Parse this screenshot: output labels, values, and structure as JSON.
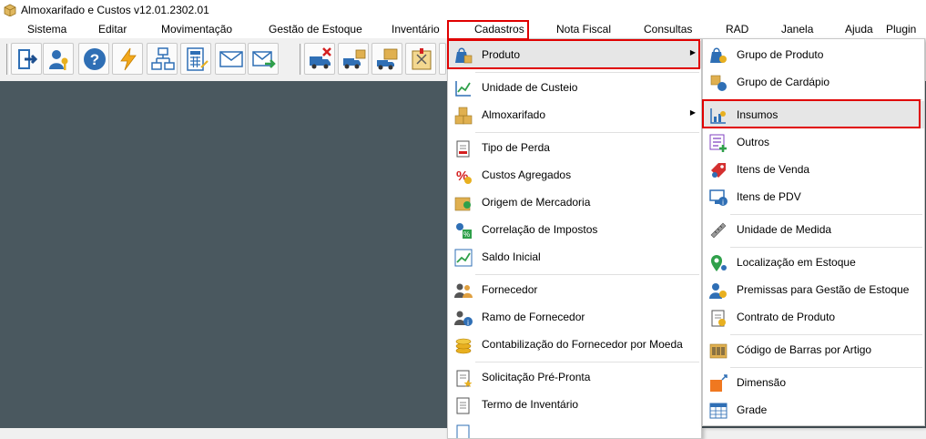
{
  "window": {
    "title": "Almoxarifado e Custos v12.01.2302.01"
  },
  "menubar": {
    "items": [
      "Sistema",
      "Editar",
      "Movimentação",
      "Gestão de Estoque",
      "Inventário",
      "Cadastros",
      "Nota Fiscal",
      "Consultas",
      "RAD",
      "Janela",
      "Ajuda",
      "Plugin"
    ]
  },
  "toolbar": {
    "buttons": [
      "exit-icon",
      "user-key-icon",
      "help-icon",
      "lightning-icon",
      "org-chart-icon",
      "calculator-icon",
      "mail-icon",
      "mail-send-icon",
      "truck-remove-icon",
      "truck-box-icon",
      "truck-transfer-icon",
      "inventory-box-icon"
    ]
  },
  "cadastros_menu": {
    "items": [
      {
        "label": "Produto",
        "icon": "produto-icon",
        "submenu": true
      },
      {
        "label": "Unidade de Custeio",
        "icon": "chart-icon"
      },
      {
        "label": "Almoxarifado",
        "icon": "boxes-icon",
        "submenu": true
      },
      {
        "label": "Tipo de Perda",
        "icon": "document-minus-icon"
      },
      {
        "label": "Custos Agregados",
        "icon": "percent-icon"
      },
      {
        "label": "Origem de Mercadoria",
        "icon": "origin-icon"
      },
      {
        "label": "Correlação de Impostos",
        "icon": "tax-icon"
      },
      {
        "label": "Saldo Inicial",
        "icon": "balance-icon"
      },
      {
        "label": "Fornecedor",
        "icon": "people-icon"
      },
      {
        "label": "Ramo de Fornecedor",
        "icon": "people-info-icon"
      },
      {
        "label": "Contabilização do Fornecedor por Moeda",
        "icon": "coins-icon"
      },
      {
        "label": "Solicitação Pré-Pronta",
        "icon": "document-star-icon"
      },
      {
        "label": "Termo de Inventário",
        "icon": "document-icon"
      }
    ]
  },
  "produto_submenu": {
    "items": [
      {
        "label": "Grupo de Produto",
        "icon": "group-product-icon"
      },
      {
        "label": "Grupo de Cardápio",
        "icon": "menu-group-icon"
      },
      {
        "label": "Insumos",
        "icon": "insumos-icon"
      },
      {
        "label": "Outros",
        "icon": "list-add-icon"
      },
      {
        "label": "Itens de Venda",
        "icon": "price-tag-icon"
      },
      {
        "label": "Itens de PDV",
        "icon": "monitor-info-icon"
      },
      {
        "label": "Unidade de Medida",
        "icon": "ruler-icon"
      },
      {
        "label": "Localização em Estoque",
        "icon": "map-pin-icon"
      },
      {
        "label": "Premissas para Gestão de Estoque",
        "icon": "person-gear-icon"
      },
      {
        "label": "Contrato de Produto",
        "icon": "contract-icon"
      },
      {
        "label": "Código de Barras por Artigo",
        "icon": "barcode-icon"
      },
      {
        "label": "Dimensão",
        "icon": "dimension-icon"
      },
      {
        "label": "Grade",
        "icon": "grid-icon"
      }
    ]
  }
}
